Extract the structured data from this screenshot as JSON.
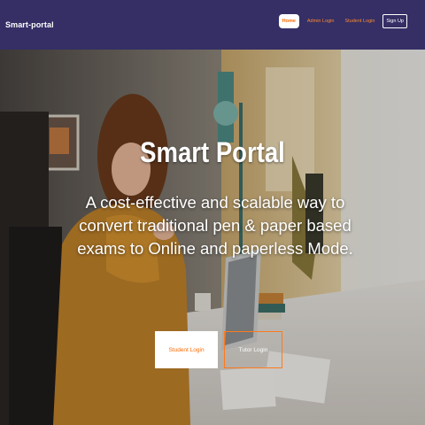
{
  "navbar": {
    "brand": "Smart-portal",
    "links": {
      "home": "Home",
      "admin": "Admin Login",
      "student": "Student Login",
      "signup": "Sign Up"
    }
  },
  "hero": {
    "title": "Smart Portal",
    "subtitle": "A cost-effective and scalable way to convert traditional pen & paper based exams to Online and paperless Mode.",
    "buttons": {
      "student": "Student Login",
      "tutor": "Tutor Login"
    }
  },
  "colors": {
    "navbar": "#352f66",
    "accent": "#ff6a00"
  }
}
